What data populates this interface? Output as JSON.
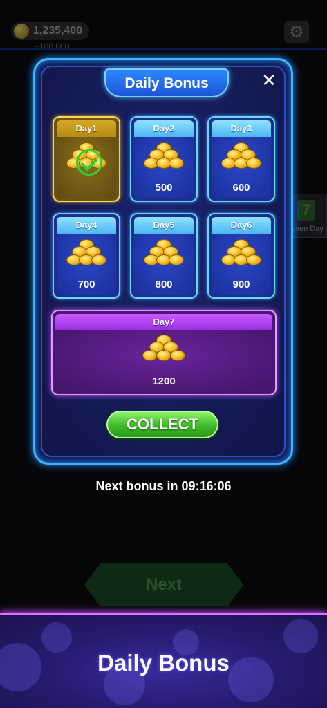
{
  "background": {
    "balance": "1,235,400",
    "balance_sub": "+100,000",
    "lucky_badge_label": "Seven Day",
    "lucky_badge_glyph": "7",
    "next_button": "Next"
  },
  "modal": {
    "title": "Daily Bonus",
    "close_glyph": "✕",
    "days": [
      {
        "label": "Day1",
        "amount": "",
        "claimed": true
      },
      {
        "label": "Day2",
        "amount": "500",
        "claimed": false
      },
      {
        "label": "Day3",
        "amount": "600",
        "claimed": false
      },
      {
        "label": "Day4",
        "amount": "700",
        "claimed": false
      },
      {
        "label": "Day5",
        "amount": "800",
        "claimed": false
      },
      {
        "label": "Day6",
        "amount": "900",
        "claimed": false
      },
      {
        "label": "Day7",
        "amount": "1200",
        "claimed": false
      }
    ],
    "collect_label": "COLLECT"
  },
  "next_bonus": "Next bonus in 09:16:06",
  "promo_title": "Daily Bonus",
  "icons": {
    "coin": "coin-stack-icon",
    "check": "check-icon",
    "gear": "gear-icon",
    "close": "close-icon"
  },
  "colors": {
    "modal_border": "#3fb5ff",
    "claimed": "#d6a923",
    "day7_accent": "#c85aff",
    "collect": "#3fb82a"
  }
}
